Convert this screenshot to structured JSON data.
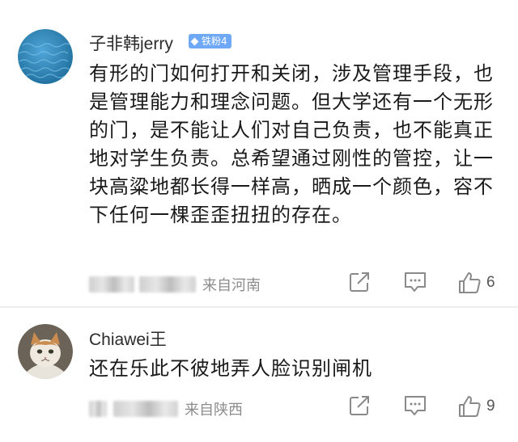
{
  "comments": [
    {
      "username": "子非韩jerry",
      "badge": "铁粉4",
      "text": "有形的门如何打开和关闭，涉及管理手段，也是管理能力和理念问题。但大学还有一个无形的门，是不能让人们对自己负责，也不能真正地对学生负责。总希望通过刚性的管控，让一块高粱地都长得一样高，晒成一个颜色，容不下任何一棵歪歪扭扭的存在。",
      "location": "来自河南",
      "like_count": "6",
      "avatar_icon": "blue-water-avatar"
    },
    {
      "username": "Chiawei王",
      "text": "还在乐此不彼地弄人脸识别闸机",
      "location": "来自陕西",
      "like_count": "9",
      "avatar_icon": "cat-avatar"
    }
  ],
  "icons": {
    "share": "share-icon",
    "reply": "comment-icon",
    "like": "thumbs-up-icon"
  },
  "colors": {
    "badge": "#6fa8f5",
    "meta_text": "#8c8c8c",
    "icon": "#8a8a8a"
  }
}
